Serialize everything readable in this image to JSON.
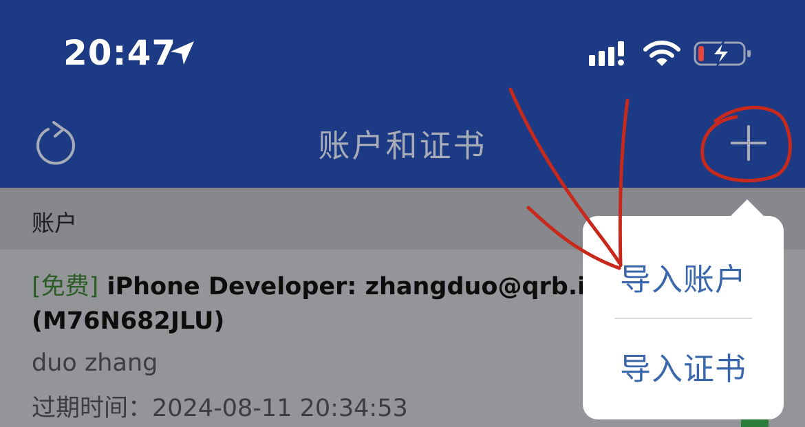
{
  "status_bar": {
    "time": "20:47",
    "icons": [
      "location-arrow-icon",
      "signal-icon",
      "wifi-icon",
      "battery-charging-icon"
    ]
  },
  "nav": {
    "title": "账户和证书",
    "left_icon": "refresh-icon",
    "right_icon": "plus-icon"
  },
  "section": {
    "label": "账户"
  },
  "account": {
    "badge": "[免费]",
    "title": "iPhone Developer: zhangduo@qrb.in",
    "team_id": "(M76N682JLU)",
    "owner": "duo zhang",
    "expiry_label": "过期时间：",
    "expiry_value": "2024-08-11 20:34:53"
  },
  "popover_menu": {
    "items": [
      {
        "label": "导入账户"
      },
      {
        "label": "导入证书"
      }
    ]
  },
  "colors": {
    "nav_background": "#1d3a84",
    "menu_text": "#3a66ab",
    "badge_green": "#2c5d27",
    "annotation_red": "#c8291d"
  }
}
